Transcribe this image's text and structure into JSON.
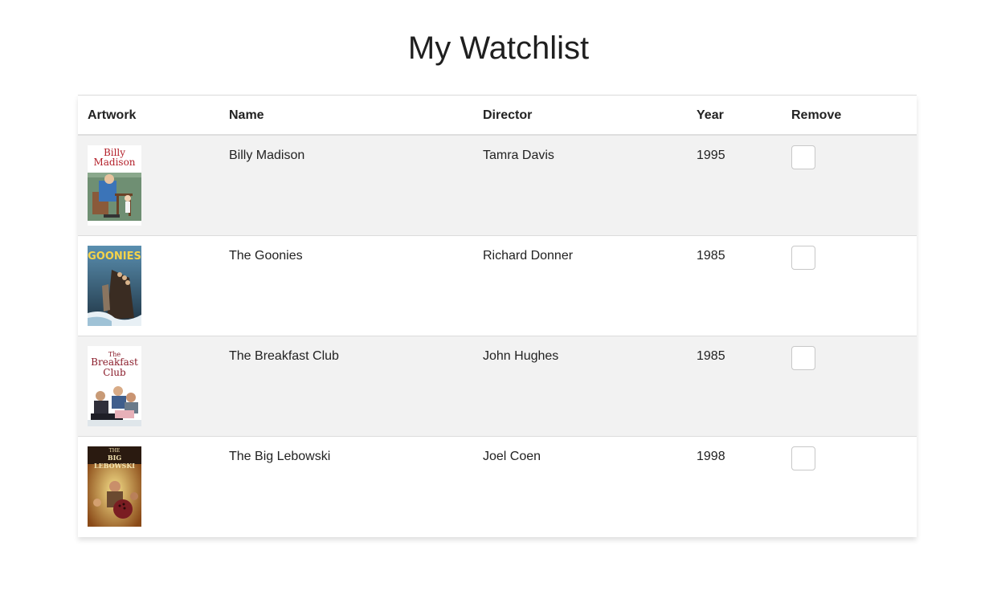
{
  "page": {
    "title": "My Watchlist"
  },
  "table": {
    "headers": {
      "artwork": "Artwork",
      "name": "Name",
      "director": "Director",
      "year": "Year",
      "remove": "Remove"
    },
    "rows": [
      {
        "name": "Billy Madison",
        "director": "Tamra Davis",
        "year": "1995",
        "artwork_title_1": "Billy",
        "artwork_title_2": "Madison",
        "selected": false
      },
      {
        "name": "The Goonies",
        "director": "Richard Donner",
        "year": "1985",
        "artwork_title_1": "GOONIES",
        "selected": false
      },
      {
        "name": "The Breakfast Club",
        "director": "John Hughes",
        "year": "1985",
        "artwork_title_1": "The",
        "artwork_title_2": "Breakfast",
        "artwork_title_3": "Club",
        "selected": false
      },
      {
        "name": "The Big Lebowski",
        "director": "Joel Coen",
        "year": "1998",
        "artwork_title_1": "THE",
        "artwork_title_2": "BIG LEBOWSKI",
        "selected": false
      }
    ]
  },
  "colors": {
    "row_stripe": "#f2f2f2",
    "border": "#dcdcdc"
  }
}
